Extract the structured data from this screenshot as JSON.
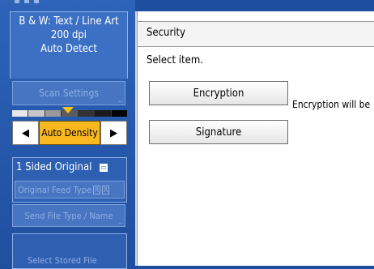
{
  "scan_mode": {
    "line1": "B & W: Text / Line Art",
    "line2": "200 dpi",
    "line3": "Auto Detect"
  },
  "left": {
    "scan_settings": "Scan Settings",
    "density_label": "Auto Density",
    "density_level": 0.5,
    "original_sided": "1 Sided Original",
    "original_feed_type": "Original Feed Type",
    "send_file_type": "Send File Type / Name",
    "select_stored_file": "Select Stored File"
  },
  "security": {
    "title": "Security",
    "prompt": "Select item.",
    "encryption_label": "Encryption",
    "encryption_desc": "Encryption will be",
    "signature_label": "Signature"
  }
}
